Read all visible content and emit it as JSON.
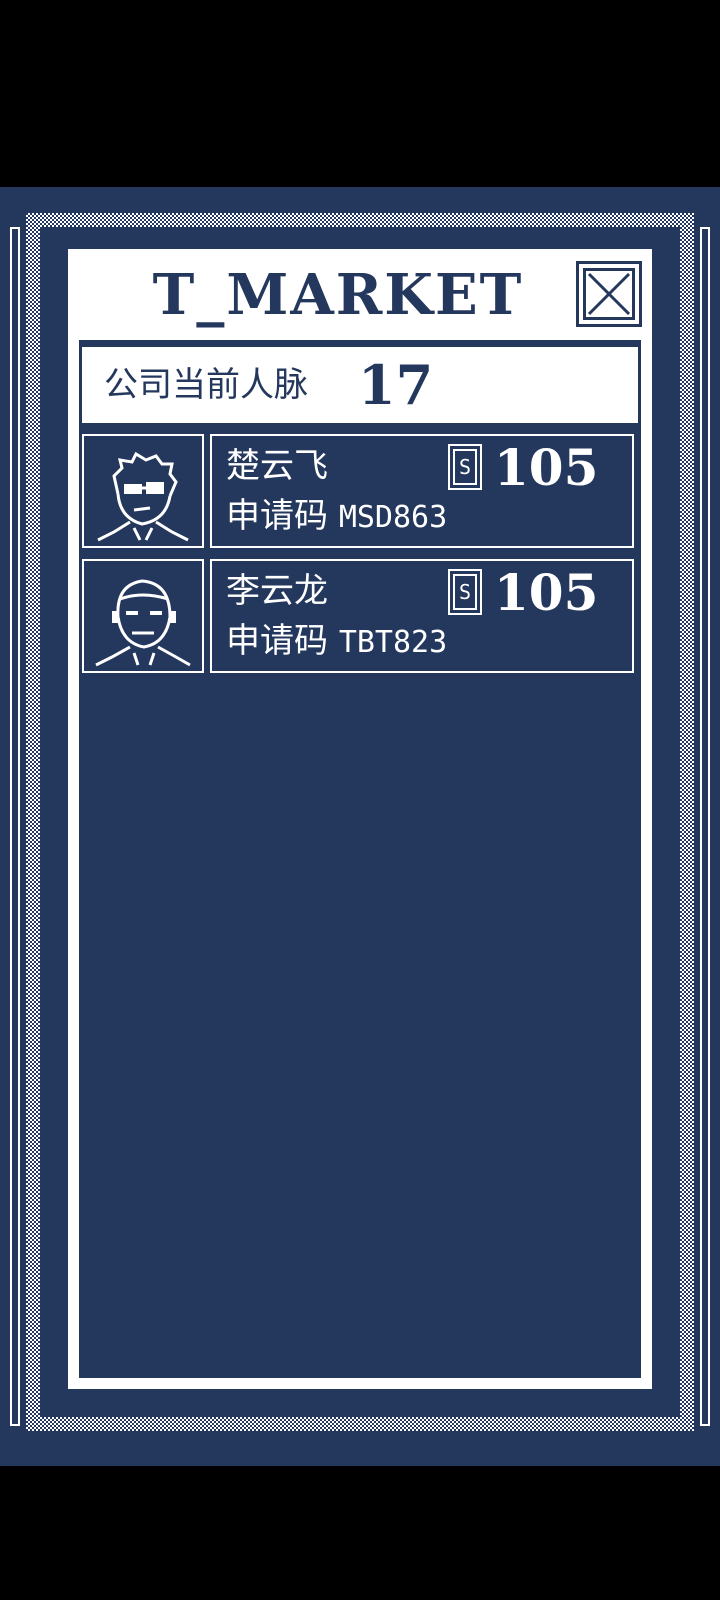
{
  "header": {
    "title": "T_MARKET",
    "close_icon": "close-x-icon"
  },
  "network": {
    "label": "公司当前人脉",
    "count": "17"
  },
  "contacts": [
    {
      "name": "楚云飞",
      "code_label": "申请码",
      "code": "MSD863",
      "price": "105",
      "currency_icon": "S",
      "avatar_icon": "avatar-spiky-hair-sunglasses-icon"
    },
    {
      "name": "李云龙",
      "code_label": "申请码",
      "code": "TBT823",
      "price": "105",
      "currency_icon": "S",
      "avatar_icon": "avatar-bald-man-icon"
    }
  ],
  "colors": {
    "background": "#24375d",
    "foreground": "#ffffff",
    "outside": "#000000"
  }
}
